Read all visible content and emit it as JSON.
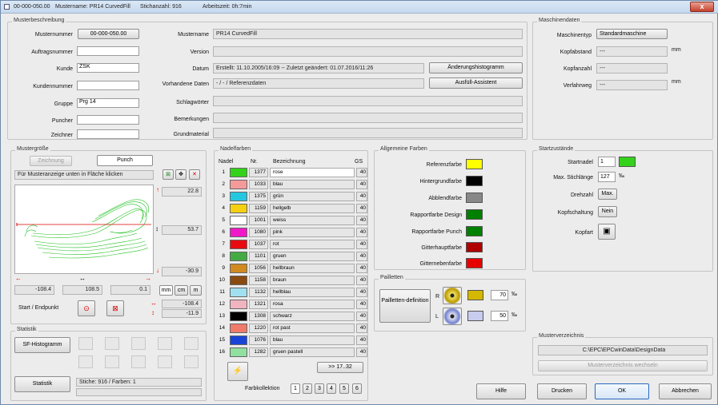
{
  "title": {
    "pattern_no": "00-000-050.00",
    "pattern_name": "Mustername: PR14 CurvedFill",
    "stitch_count": "Stichanzahl: 916",
    "work_time": "Arbeitszeit: 0h:7min",
    "close": "x"
  },
  "desc": {
    "legend": "Musterbeschreibung",
    "musternummer_label": "Musternummer",
    "musternummer": "00-000-050.00",
    "auftrag_label": "Auftragsnummer",
    "auftrag": "",
    "kunde_label": "Kunde",
    "kunde": "ZSK",
    "kundennummer_label": "Kundennummer",
    "kundennummer": "",
    "gruppe_label": "Gruppe",
    "gruppe": "Prg 14",
    "puncher_label": "Puncher",
    "puncher": "",
    "zeichner_label": "Zeichner",
    "zeichner": "",
    "mustername_label": "Mustername",
    "mustername": "PR14 CurvedFill",
    "version_label": "Version",
    "version": "",
    "datum_label": "Datum",
    "datum": "Erstellt: 11.10.2005/16:09 -- Zuletzt geändert: 01.07.2016/11:26",
    "history_btn": "Änderungshistogramm",
    "daten_label": "Vorhandene Daten",
    "daten": "- / - / Referenzdaten",
    "assist_btn": "Ausfüll-Assistent",
    "schlag_label": "Schlagwörter",
    "schlag": "",
    "bem_label": "Bemerkungen",
    "bem": "",
    "grund_label": "Grundmaterial",
    "grund": ""
  },
  "machine": {
    "legend": "Maschinendaten",
    "typ_label": "Maschinentyp",
    "typ": "Standardmaschine",
    "abstand_label": "Kopfabstand",
    "abstand": "---",
    "abstand_unit": "mm",
    "anzahl_label": "Kopfanzahl",
    "anzahl": "---",
    "weg_label": "Verfahrweg",
    "weg": "---",
    "weg_unit": "mm"
  },
  "size": {
    "legend": "Mustergröße",
    "zeichnung": "Zeichnung",
    "punch": "Punch",
    "hint": "Für Musteranzeige unten in Fläche klicken",
    "top": "22.8",
    "mid": "53.7",
    "bottom": "-30.9",
    "left": "-108.4",
    "width": "108.5",
    "right": "0.1",
    "mm": "mm",
    "cm": "cm",
    "m": "m",
    "start_label": "Start / Endpunkt",
    "sx": "-108.4",
    "sy": "-11.9",
    "plus": "✥",
    "x_icon": "✕",
    "check": "⊠"
  },
  "needles": {
    "legend": "Nadelfarben",
    "h_nadel": "Nadel",
    "h_nr": "Nr.",
    "h_bez": "Bezeichnung",
    "h_gs": "GS",
    "rows": [
      {
        "n": "1",
        "c": "#34d21a",
        "nr": "1377",
        "bez": "rose",
        "gs": "40"
      },
      {
        "n": "2",
        "c": "#f59a9a",
        "nr": "1033",
        "bez": "blau",
        "gs": "40"
      },
      {
        "n": "3",
        "c": "#24c6e0",
        "nr": "1375",
        "bez": "grün",
        "gs": "40"
      },
      {
        "n": "4",
        "c": "#f5d010",
        "nr": "1159",
        "bez": "hellgelb",
        "gs": "40"
      },
      {
        "n": "5",
        "c": "#ffffff",
        "nr": "1001",
        "bez": "weiss",
        "gs": "40"
      },
      {
        "n": "6",
        "c": "#f018c8",
        "nr": "1080",
        "bez": "pink",
        "gs": "40"
      },
      {
        "n": "7",
        "c": "#e80a10",
        "nr": "1037",
        "bez": "rot",
        "gs": "40"
      },
      {
        "n": "8",
        "c": "#44aa44",
        "nr": "1101",
        "bez": "gruen",
        "gs": "40"
      },
      {
        "n": "9",
        "c": "#d08a20",
        "nr": "1056",
        "bez": "hellbraun",
        "gs": "40"
      },
      {
        "n": "10",
        "c": "#8a4a10",
        "nr": "1158",
        "bez": "braun",
        "gs": "40"
      },
      {
        "n": "11",
        "c": "#a0e0f0",
        "nr": "1132",
        "bez": "hellblau",
        "gs": "40"
      },
      {
        "n": "12",
        "c": "#f0b4c0",
        "nr": "1321",
        "bez": "rosa",
        "gs": "40"
      },
      {
        "n": "13",
        "c": "#000000",
        "nr": "1308",
        "bez": "schwarz",
        "gs": "40"
      },
      {
        "n": "14",
        "c": "#f07a6a",
        "nr": "1220",
        "bez": "rot past",
        "gs": "40"
      },
      {
        "n": "15",
        "c": "#1a44d8",
        "nr": "1076",
        "bez": "blau",
        "gs": "40"
      },
      {
        "n": "16",
        "c": "#90e0a0",
        "nr": "1282",
        "bez": "gruen pastell",
        "gs": "40"
      }
    ],
    "next": ">> 17..32",
    "kollektion": "Farbkollektion",
    "k": [
      "1",
      "2",
      "3",
      "4",
      "5",
      "6"
    ]
  },
  "colors": {
    "legend": "Allgemeine Farben",
    "ref": "Referenzfarbe",
    "hint": "Hintergrundfarbe",
    "abb": "Abblendfarbe",
    "rd": "Rapportfarbe Design",
    "rp": "Rapportfarbe Punch",
    "gh": "Gitterhauptfarbe",
    "gn": "Gitternebenfarbe",
    "c_ref": "#ffff00",
    "c_hint": "#000000",
    "c_abb": "#888888",
    "c_rd": "#008000",
    "c_rp": "#008000",
    "c_gh": "#b00000",
    "c_gn": "#e80000"
  },
  "pail": {
    "legend": "Pailletten",
    "def": "Pailletten-definition",
    "r": "R",
    "l": "L",
    "r_val": "70",
    "l_val": "50",
    "unit": "‰",
    "c_r": "#d4b800",
    "c_l": "#c8ccee"
  },
  "start": {
    "legend": "Startzustände",
    "nadel_label": "Startnadel",
    "nadel": "1",
    "len_label": "Max. Stichlänge",
    "len": "127",
    "len_unit": "‰",
    "dreh_label": "Drehzahl",
    "dreh": "Max.",
    "kopf_label": "Kopfschaltung",
    "kopf": "Nein",
    "art_label": "Kopfart",
    "c_nadel": "#34d21a"
  },
  "stat": {
    "legend": "Statistik",
    "sf": "SF-Histogramm",
    "btn": "Statistik",
    "info": "Stiche: 916 / Farben: 1"
  },
  "dir": {
    "legend": "Musterverzeichnis",
    "path": "C:\\EPC\\EPCwinData\\DesignData",
    "change": "Musterverzeichnis wechseln"
  },
  "buttons": {
    "hilfe": "Hilfe",
    "drucken": "Drucken",
    "ok": "OK",
    "abbrechen": "Abbrechen"
  }
}
